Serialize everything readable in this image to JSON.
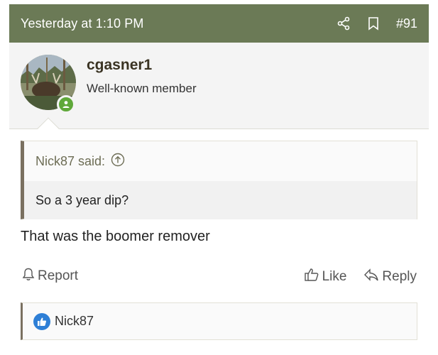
{
  "header": {
    "timestamp": "Yesterday at 1:10 PM",
    "post_number": "#91",
    "background_color": "#6b7a56"
  },
  "user": {
    "username": "cgasner1",
    "title": "Well-known member",
    "status_color": "#5fa83a"
  },
  "quote": {
    "author_label": "Nick87 said:",
    "text": "So a 3 year dip?"
  },
  "message": {
    "text": "That was the boomer remover"
  },
  "actions": {
    "report": "Report",
    "like": "Like",
    "reply": "Reply"
  },
  "reactions": {
    "users": "Nick87",
    "badge_color": "#2e7fd6"
  }
}
